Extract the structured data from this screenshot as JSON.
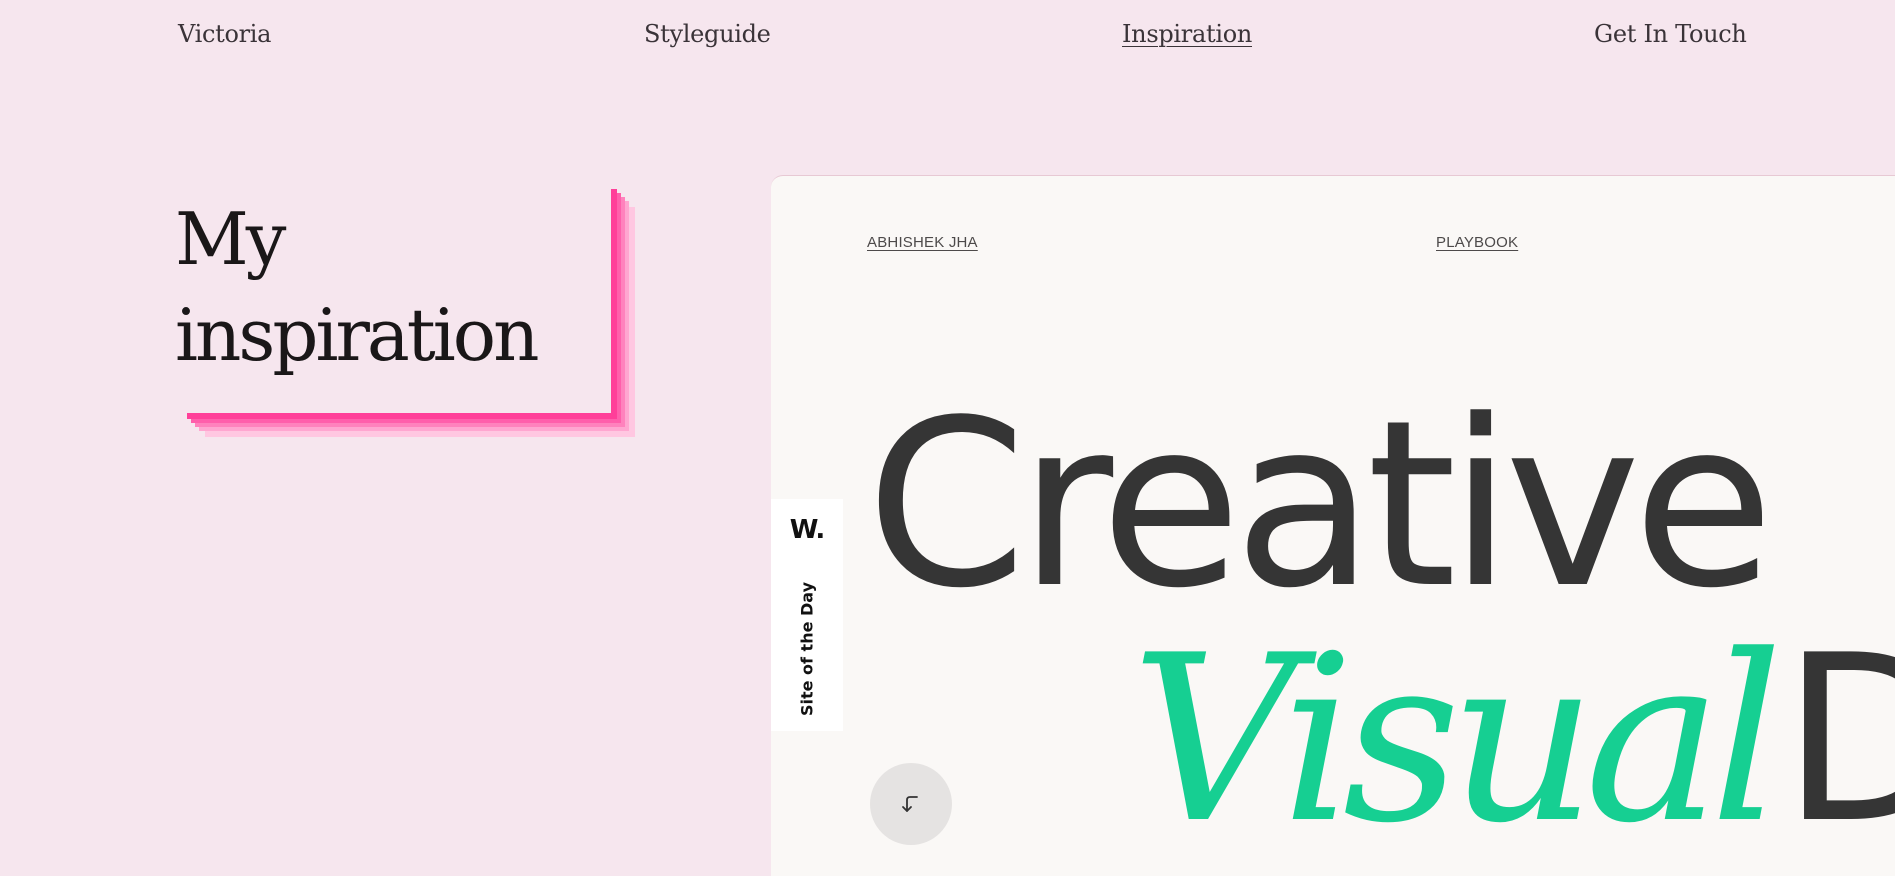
{
  "nav": {
    "items": [
      {
        "label": "Victoria"
      },
      {
        "label": "Styleguide"
      },
      {
        "label": "Inspiration",
        "active": true
      },
      {
        "label": "Get In Touch"
      }
    ]
  },
  "hero": {
    "title": "My\ninspiration",
    "shadow_colors": [
      "#ff3f99",
      "#ff5fab",
      "#ff82bd",
      "#ffa6d0",
      "#ffc7e1"
    ]
  },
  "preview": {
    "author_link": "ABHISHEK JHA",
    "playbook_link": "PLAYBOOK",
    "headline_line1": "Creative",
    "headline_accent": "Visual",
    "headline_rest": "De",
    "accent_color": "#16cf92",
    "award": {
      "logo": "W.",
      "label": "Site of the Day"
    },
    "scroll_icon": "arrow-down-left-icon"
  },
  "colors": {
    "page_background": "#f6e6ee",
    "card_background": "#faf8f6",
    "text_dark": "#353535"
  }
}
